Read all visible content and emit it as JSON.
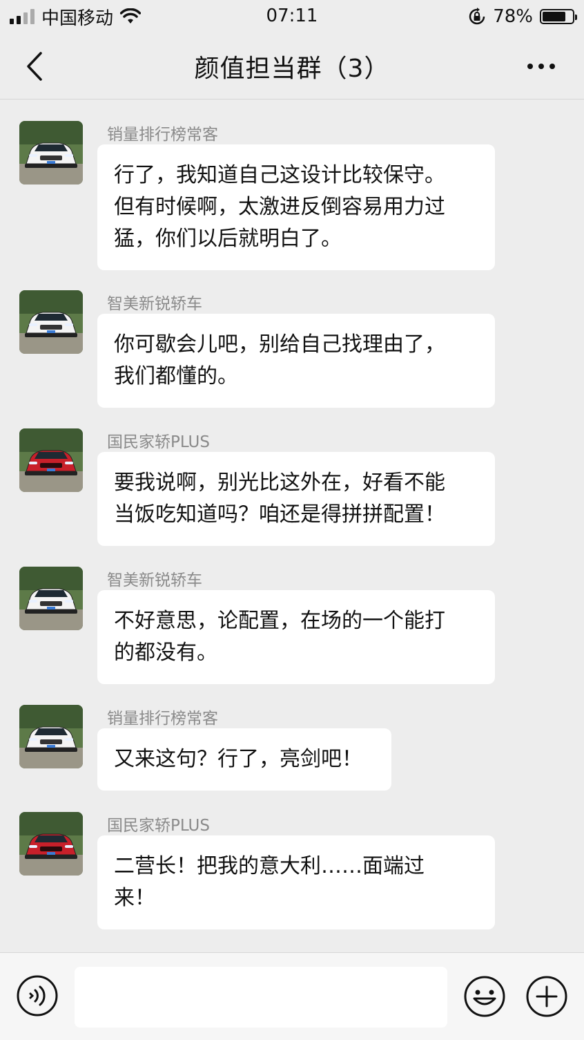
{
  "status_bar": {
    "carrier": "中国移动",
    "time": "07:11",
    "battery_percent": "78%",
    "battery_level": 0.78
  },
  "nav": {
    "title": "颜值担当群（3）"
  },
  "messages": [
    {
      "sender": "销量排行榜常客",
      "car_color": "white",
      "lines": [
        "行了，我知道自己这设计比较保守。",
        "但有时候啊，太激进反倒容易用力过",
        "猛，你们以后就明白了。"
      ]
    },
    {
      "sender": "智美新锐轿车",
      "car_color": "white",
      "lines": [
        "你可歇会儿吧，别给自己找理由了，",
        "我们都懂的。"
      ]
    },
    {
      "sender": "国民家轿PLUS",
      "car_color": "red",
      "lines": [
        "要我说啊，别光比这外在，好看不能",
        "当饭吃知道吗？咱还是得拼拼配置！"
      ]
    },
    {
      "sender": "智美新锐轿车",
      "car_color": "white",
      "lines": [
        "不好意思，论配置，在场的一个能打",
        "的都没有。"
      ]
    },
    {
      "sender": "销量排行榜常客",
      "car_color": "white",
      "lines": [
        "又来这句？行了，亮剑吧！"
      ]
    },
    {
      "sender": "国民家轿PLUS",
      "car_color": "red",
      "lines": [
        "二营长！把我的意大利……面端过",
        "来！"
      ]
    }
  ],
  "input": {
    "value": "",
    "placeholder": ""
  },
  "icons": {
    "back": "chevron-left-icon",
    "more": "more-dots-icon",
    "voice": "voice-icon",
    "emoji": "emoji-icon",
    "plus": "plus-icon"
  },
  "colors": {
    "background": "#ededed",
    "bubble": "#ffffff",
    "sender_text": "#8a8a8a"
  }
}
